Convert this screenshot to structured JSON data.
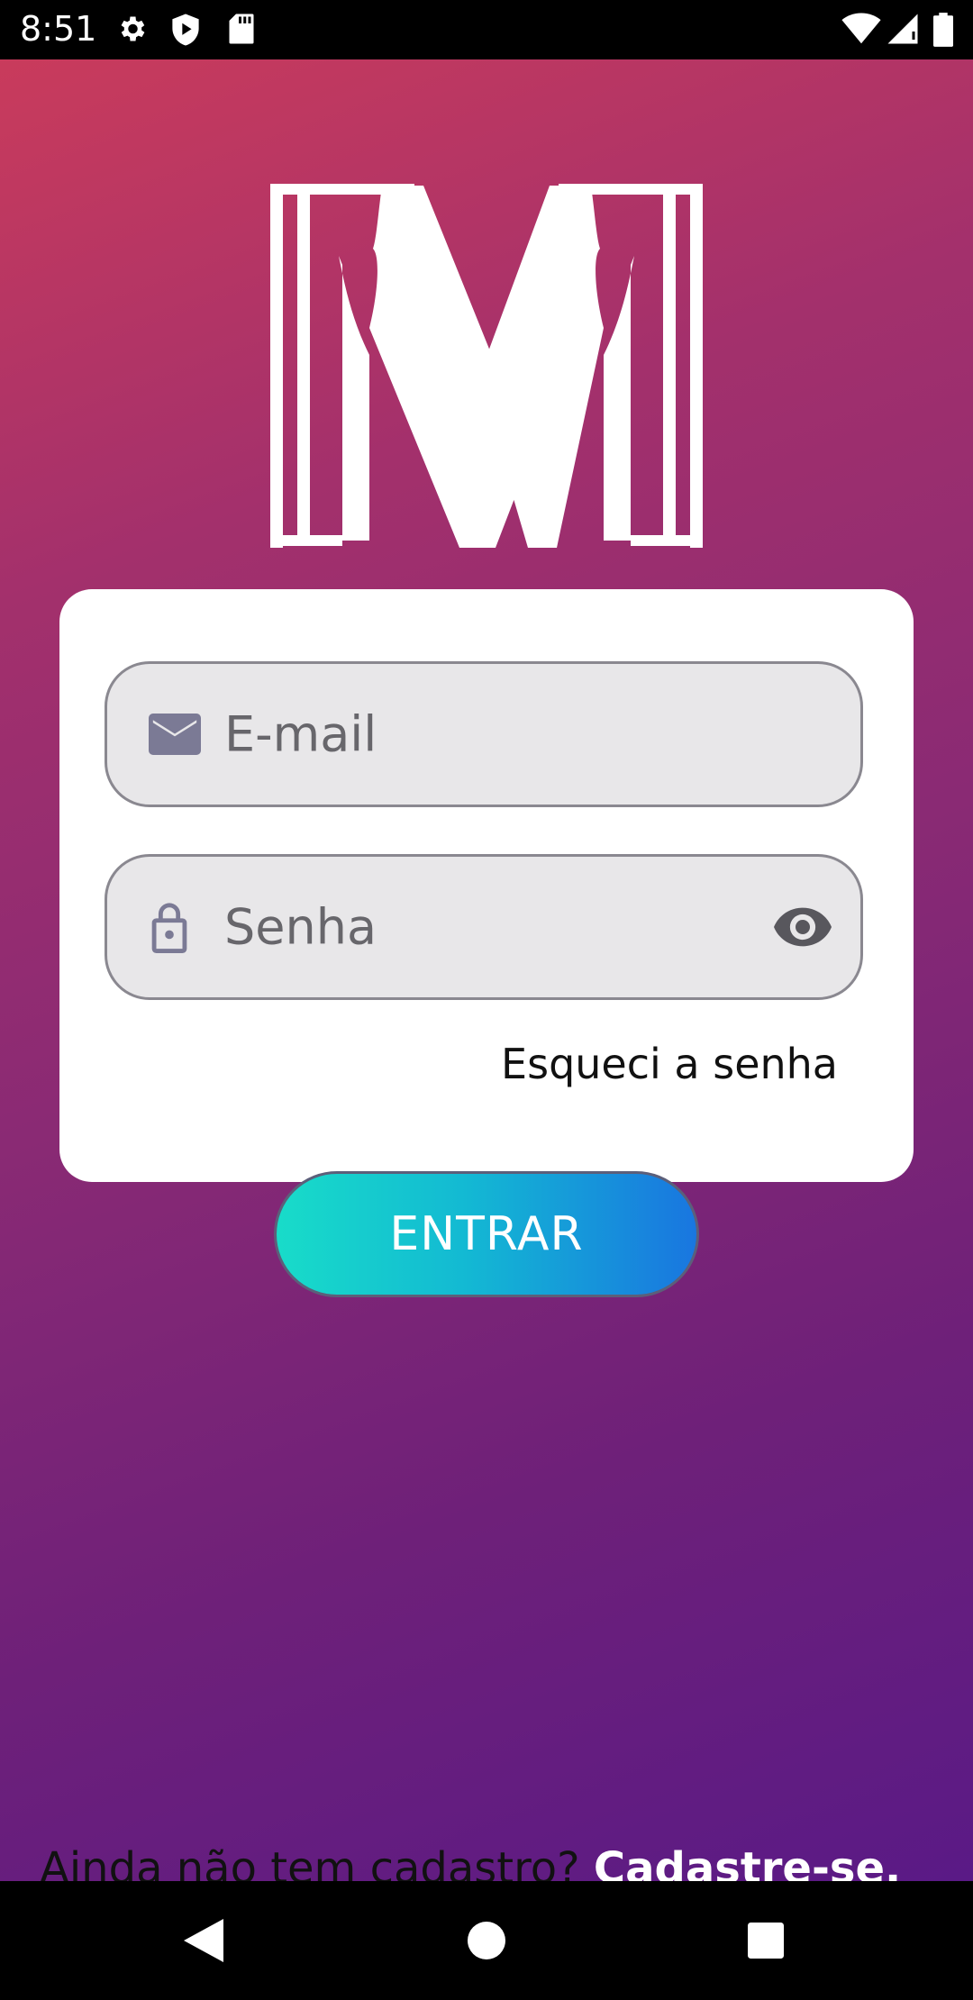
{
  "status_bar": {
    "time": "8:51",
    "left_icons": [
      "gear-icon",
      "shield-play-icon",
      "sd-card-icon"
    ],
    "right_icons": [
      "wifi-icon",
      "cell-signal-icon",
      "battery-icon"
    ]
  },
  "colors": {
    "gradient_top": "#c93b5c",
    "gradient_bottom": "#5a1a86",
    "button_start": "#18dcc9",
    "button_end": "#1976e0",
    "field_bg": "#e8e7e9",
    "icon_color": "#7b7a95"
  },
  "logo": {
    "letter": "M"
  },
  "login": {
    "email_placeholder": "E-mail",
    "email_icon": "envelope-icon",
    "password_placeholder": "Senha",
    "password_icon": "lock-icon",
    "visibility_icon": "eye-icon",
    "forgot_label": "Esqueci a senha",
    "submit_label": "ENTRAR"
  },
  "signup": {
    "prompt": "Ainda não tem cadastro?",
    "link": "Cadastre-se."
  },
  "nav_bar": {
    "buttons": [
      "back-triangle-icon",
      "home-circle-icon",
      "recents-square-icon"
    ]
  }
}
